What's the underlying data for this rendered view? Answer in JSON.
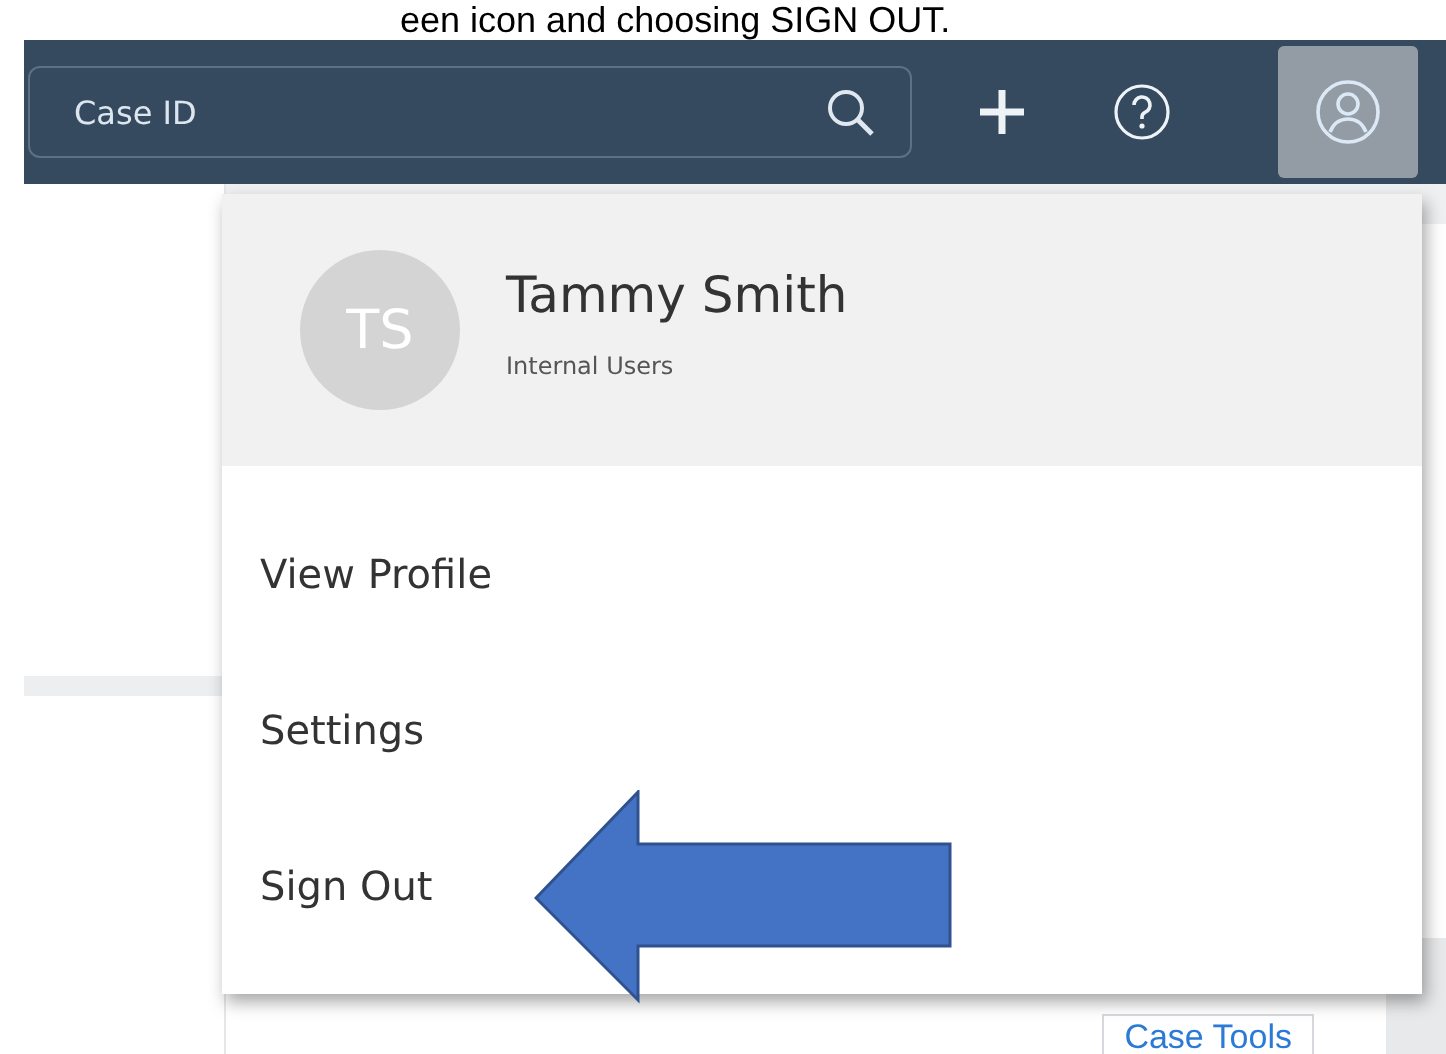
{
  "caption": "een icon and choosing SIGN OUT.",
  "header": {
    "search": {
      "placeholder": "Case ID"
    },
    "user_button": {
      "selected": true
    }
  },
  "user_menu": {
    "initials": "TS",
    "name": "Tammy Smith",
    "group": "Internal Users",
    "items": [
      {
        "label": "View Profile"
      },
      {
        "label": "Settings"
      },
      {
        "label": "Sign Out"
      }
    ]
  },
  "background": {
    "button": "Case Tools"
  }
}
